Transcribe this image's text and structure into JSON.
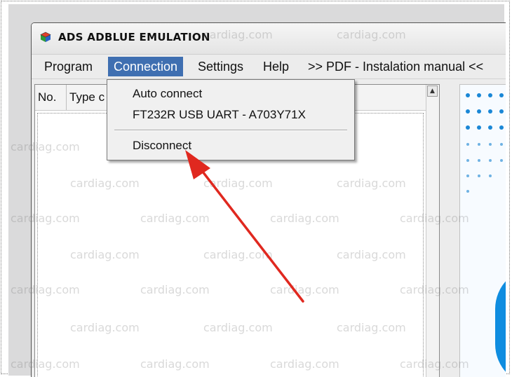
{
  "window": {
    "title": "ADS ADBLUE EMULATION",
    "app_icon": "app-cube-icon"
  },
  "menubar": {
    "items": [
      {
        "label": "Program"
      },
      {
        "label": "Connection",
        "active": true
      },
      {
        "label": "Settings"
      },
      {
        "label": "Help"
      },
      {
        "label": ">> PDF - Instalation manual <<"
      }
    ]
  },
  "listview": {
    "columns": [
      "No.",
      "Type c"
    ],
    "scroll_up_glyph": "▲"
  },
  "connection_menu": {
    "items": [
      "Auto connect",
      "FT232R USB UART - A703Y71X",
      "Disconnect"
    ]
  },
  "watermark": {
    "text": "cardiag.com"
  },
  "colors": {
    "menu_active": "#3f6fb1",
    "arrow": "#e0281f",
    "panel_dots": "#1a87d6"
  },
  "annotation": {
    "icon": "red-arrow-pointer"
  }
}
